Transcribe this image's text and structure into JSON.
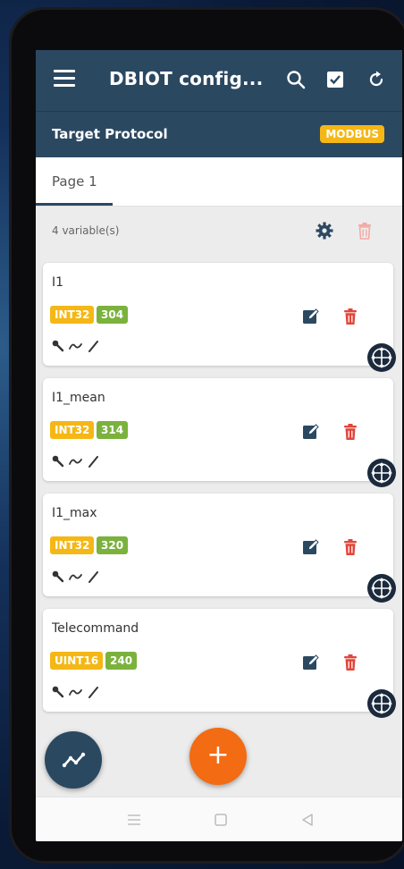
{
  "appbar": {
    "title": "DBIOT config...",
    "icons": [
      "menu-icon",
      "search-icon",
      "checkbox-icon",
      "refresh-icon"
    ]
  },
  "protocol": {
    "label": "Target Protocol",
    "value": "MODBUS"
  },
  "tabs": [
    {
      "label": "Page 1",
      "active": true
    }
  ],
  "summary": {
    "count_text": "4 variable(s)"
  },
  "variables": [
    {
      "name": "I1",
      "type": "INT32",
      "address": "304"
    },
    {
      "name": "I1_mean",
      "type": "INT32",
      "address": "314"
    },
    {
      "name": "I1_max",
      "type": "INT32",
      "address": "320"
    },
    {
      "name": "Telecommand",
      "type": "UINT16",
      "address": "240"
    }
  ],
  "fab": {
    "add_label": "+"
  },
  "colors": {
    "primary": "#2b4861",
    "accent_badge": "#f5b715",
    "address_badge": "#7ab23d",
    "delete": "#e0463c",
    "fab_add": "#f36b12"
  }
}
